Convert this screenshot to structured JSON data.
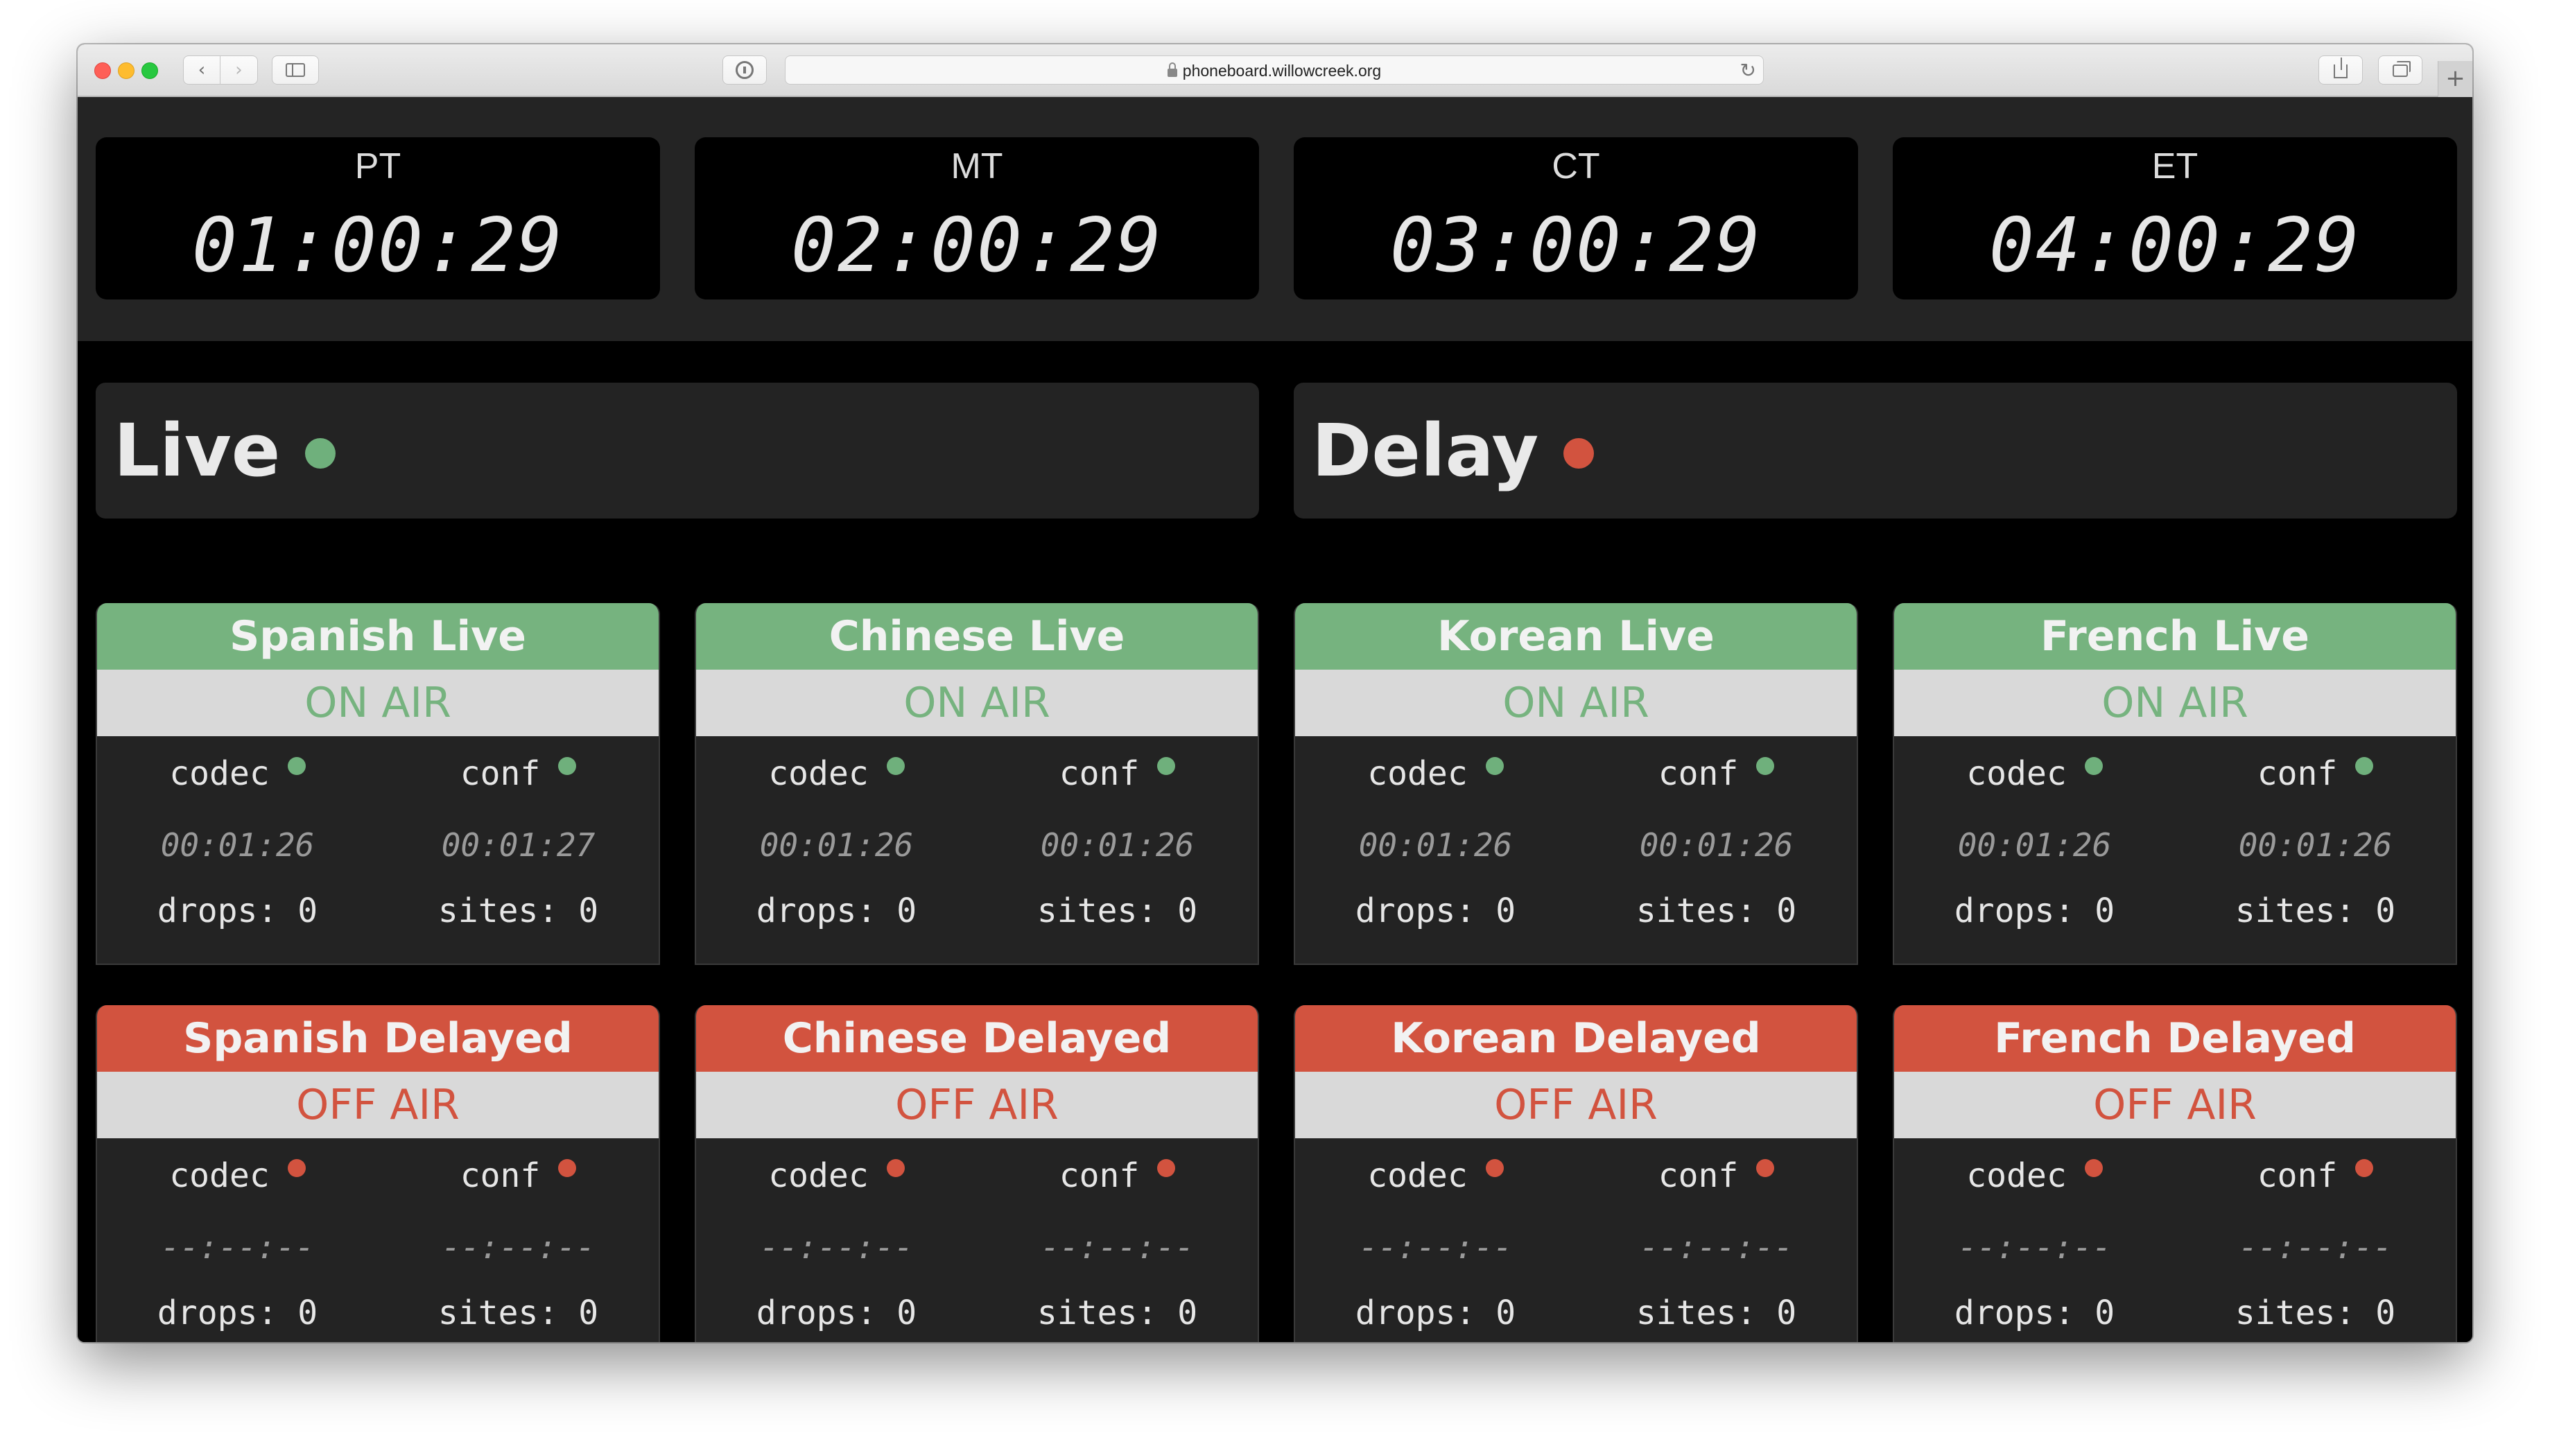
{
  "browser": {
    "url": "phoneboard.willowcreek.org",
    "back_icon": "‹",
    "forward_icon": "›",
    "reload_icon": "↻",
    "new_tab_icon": "+"
  },
  "clocks": [
    {
      "zone": "PT",
      "time": "01:00:29"
    },
    {
      "zone": "MT",
      "time": "02:00:29"
    },
    {
      "zone": "CT",
      "time": "03:00:29"
    },
    {
      "zone": "ET",
      "time": "04:00:29"
    }
  ],
  "sections": {
    "live": {
      "title": "Live",
      "color": "#6fb07c"
    },
    "delay": {
      "title": "Delay",
      "color": "#d2533f"
    }
  },
  "colors": {
    "on_air": "#76b37f",
    "off_air": "#d2533f",
    "dot_green": "#6fb07c",
    "dot_red": "#d2533f"
  },
  "labels": {
    "codec": "codec",
    "conf": "conf",
    "drops": "drops:",
    "sites": "sites:"
  },
  "live_channels": [
    {
      "name": "Spanish Live",
      "status": "ON AIR",
      "codec_time": "00:01:26",
      "conf_time": "00:01:27",
      "drops": "0",
      "sites": "0"
    },
    {
      "name": "Chinese Live",
      "status": "ON AIR",
      "codec_time": "00:01:26",
      "conf_time": "00:01:26",
      "drops": "0",
      "sites": "0"
    },
    {
      "name": "Korean Live",
      "status": "ON AIR",
      "codec_time": "00:01:26",
      "conf_time": "00:01:26",
      "drops": "0",
      "sites": "0"
    },
    {
      "name": "French Live",
      "status": "ON AIR",
      "codec_time": "00:01:26",
      "conf_time": "00:01:26",
      "drops": "0",
      "sites": "0"
    }
  ],
  "delay_channels": [
    {
      "name": "Spanish Delayed",
      "status": "OFF AIR",
      "codec_time": "--:--:--",
      "conf_time": "--:--:--",
      "drops": "0",
      "sites": "0"
    },
    {
      "name": "Chinese Delayed",
      "status": "OFF AIR",
      "codec_time": "--:--:--",
      "conf_time": "--:--:--",
      "drops": "0",
      "sites": "0"
    },
    {
      "name": "Korean Delayed",
      "status": "OFF AIR",
      "codec_time": "--:--:--",
      "conf_time": "--:--:--",
      "drops": "0",
      "sites": "0"
    },
    {
      "name": "French Delayed",
      "status": "OFF AIR",
      "codec_time": "--:--:--",
      "conf_time": "--:--:--",
      "drops": "0",
      "sites": "0"
    }
  ]
}
